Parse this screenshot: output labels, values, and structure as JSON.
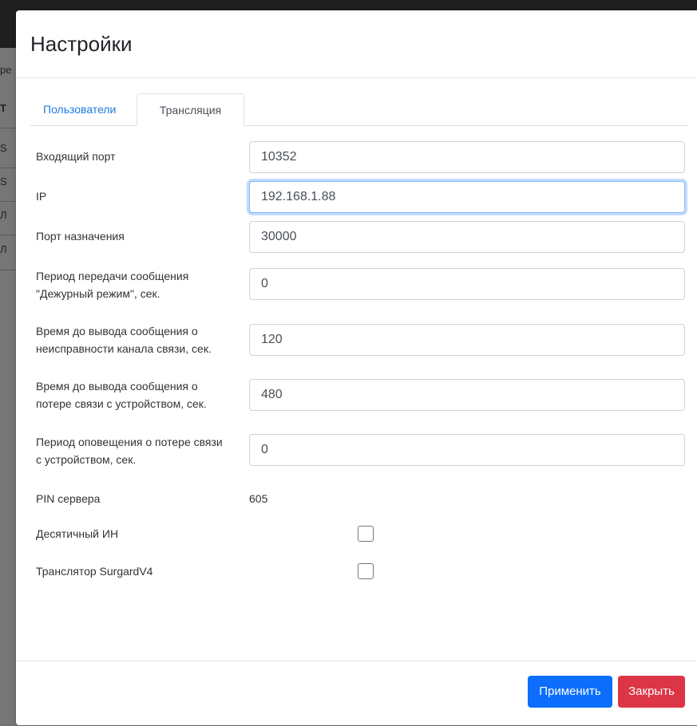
{
  "background": {
    "fragments": [
      "ре",
      "Т",
      "S",
      "S",
      "Л",
      "Л"
    ]
  },
  "modal": {
    "title": "Настройки",
    "tabs": [
      {
        "label": "Пользователи",
        "active": false
      },
      {
        "label": "Трансляция",
        "active": true
      }
    ],
    "fields": {
      "incoming_port": {
        "label": "Входящий порт",
        "value": "10352"
      },
      "ip": {
        "label": "IP",
        "value": "192.168.1.88"
      },
      "dest_port": {
        "label": "Порт назначения",
        "value": "30000"
      },
      "duty_period": {
        "label_line1": "Период передачи сообщения",
        "label_line2": "\"Дежурный режим\", сек.",
        "value": "0"
      },
      "channel_fault_time": {
        "label_line1": "Время до вывода сообщения о",
        "label_line2": "неисправности канала связи, сек.",
        "value": "120"
      },
      "connection_loss_time": {
        "label_line1": "Время до вывода сообщения о",
        "label_line2": "потере связи с устройством, сек.",
        "value": "480"
      },
      "loss_notify_period": {
        "label_line1": "Период оповещения о потере связи",
        "label_line2": "с устройством, сек.",
        "value": "0"
      },
      "server_pin": {
        "label": "PIN сервера",
        "value": "605"
      },
      "decimal_id": {
        "label": "Десятичный ИН",
        "checked": false
      },
      "surgard": {
        "label": "Транслятор SurgardV4",
        "checked": false
      }
    },
    "buttons": {
      "apply": "Применить",
      "close": "Закрыть"
    },
    "colors": {
      "primary": "#0d6efd",
      "danger": "#dc3545",
      "link": "#1e7be0"
    }
  }
}
